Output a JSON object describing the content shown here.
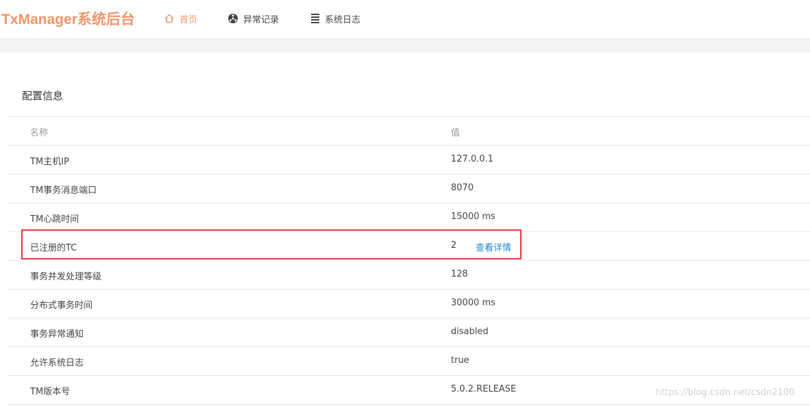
{
  "header": {
    "brand": "TxManager系统后台",
    "nav": [
      {
        "label": "首页",
        "icon": "home-icon",
        "active": true
      },
      {
        "label": "异常记录",
        "icon": "radiation-icon",
        "active": false
      },
      {
        "label": "系统日志",
        "icon": "list-icon",
        "active": false
      }
    ]
  },
  "section": {
    "title": "配置信息"
  },
  "table": {
    "columns": [
      "名称",
      "值"
    ],
    "rows": [
      {
        "name": "TM主机IP",
        "value": "127.0.0.1"
      },
      {
        "name": "TM事务消息端口",
        "value": "8070"
      },
      {
        "name": "TM心跳时间",
        "value": "15000 ms"
      },
      {
        "name": "已注册的TC",
        "value": "2",
        "link": "查看详情"
      },
      {
        "name": "事务并发处理等级",
        "value": "128"
      },
      {
        "name": "分布式事务时间",
        "value": "30000 ms"
      },
      {
        "name": "事务异常通知",
        "value": "disabled"
      },
      {
        "name": "允许系统日志",
        "value": "true"
      },
      {
        "name": "TM版本号",
        "value": "5.0.2.RELEASE"
      }
    ]
  },
  "watermark": "https://blog.csdn.net/csdn2100",
  "colors": {
    "accent": "#f0956b",
    "link": "#1e88d8",
    "highlight": "#e03b3b"
  }
}
